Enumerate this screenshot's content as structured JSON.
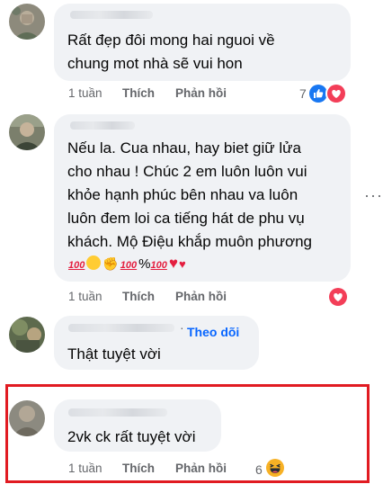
{
  "comments": [
    {
      "text": "Rất đẹp đôi mong hai nguoi về\nchung mot nhà sẽ vui hon",
      "time": "1 tuần",
      "like_label": "Thích",
      "reply_label": "Phản hồi",
      "reaction_count": "7"
    },
    {
      "text": "Nếu la. Cua nhau, hay biet giữ lửa\ncho nhau ! Chúc 2 em luôn luôn vui\nkhỏe hạnh phúc bên nhau va luôn\nluôn đem loi ca tiếng hát de phu vụ\nkhách. Mộ Điệu khắp muôn phương",
      "emoji_percent": "%",
      "time": "1 tuần",
      "like_label": "Thích",
      "reply_label": "Phản hồi"
    },
    {
      "text": "Thật tuyệt vời",
      "follow_label": "Theo dõi",
      "time": "1 tuần",
      "like_label": "Thích",
      "reply_label": "Phản hồi"
    },
    {
      "text": "2vk ck rất tuyệt vời",
      "time": "1 tuần",
      "like_label": "Thích",
      "reply_label": "Phản hồi",
      "reaction_count": "6"
    }
  ],
  "colors": {
    "bubble": "#f0f2f5",
    "meta_text": "#65676b",
    "follow_blue": "#0866ff",
    "highlight_red": "#e11b22",
    "heart_red": "#e41e3f",
    "like_blue": "#1877f2"
  },
  "icons": {
    "like": "like-reaction-icon",
    "love": "love-reaction-icon",
    "haha": "haha-reaction-icon",
    "more": "more-options-icon"
  }
}
